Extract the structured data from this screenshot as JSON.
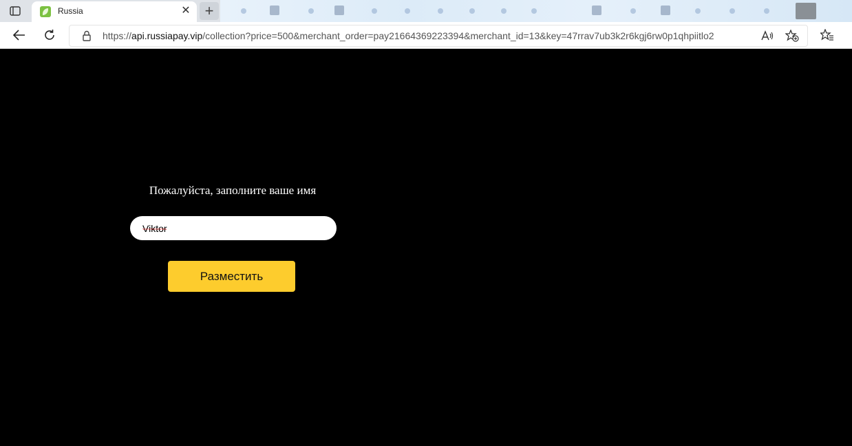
{
  "browser": {
    "tab": {
      "title": "Russia",
      "close_glyph": "✕"
    },
    "new_tab_glyph": "+",
    "address": {
      "url_prefix": "https://",
      "url_host": "api.russiapay.vip",
      "url_rest": "/collection?price=500&merchant_order=pay21664369223394&merchant_id=13&key=47rrav7ub3k2r6kgj6rw0p1qhpiitlo2"
    },
    "icons": {
      "tab_actions": "tab-actions-icon",
      "back": "arrow-left-icon",
      "refresh": "refresh-icon",
      "lock": "lock-icon",
      "read_aloud": "read-aloud-icon",
      "add_favorite": "star-add-icon",
      "favorites": "favorites-icon"
    }
  },
  "form": {
    "prompt": "Пожалуйста, заполните ваше имя",
    "name_value": "Viktor",
    "submit_label": "Разместить"
  },
  "colors": {
    "page_background": "#000000",
    "button": "#fdcc2d",
    "input": "#ffffff"
  }
}
